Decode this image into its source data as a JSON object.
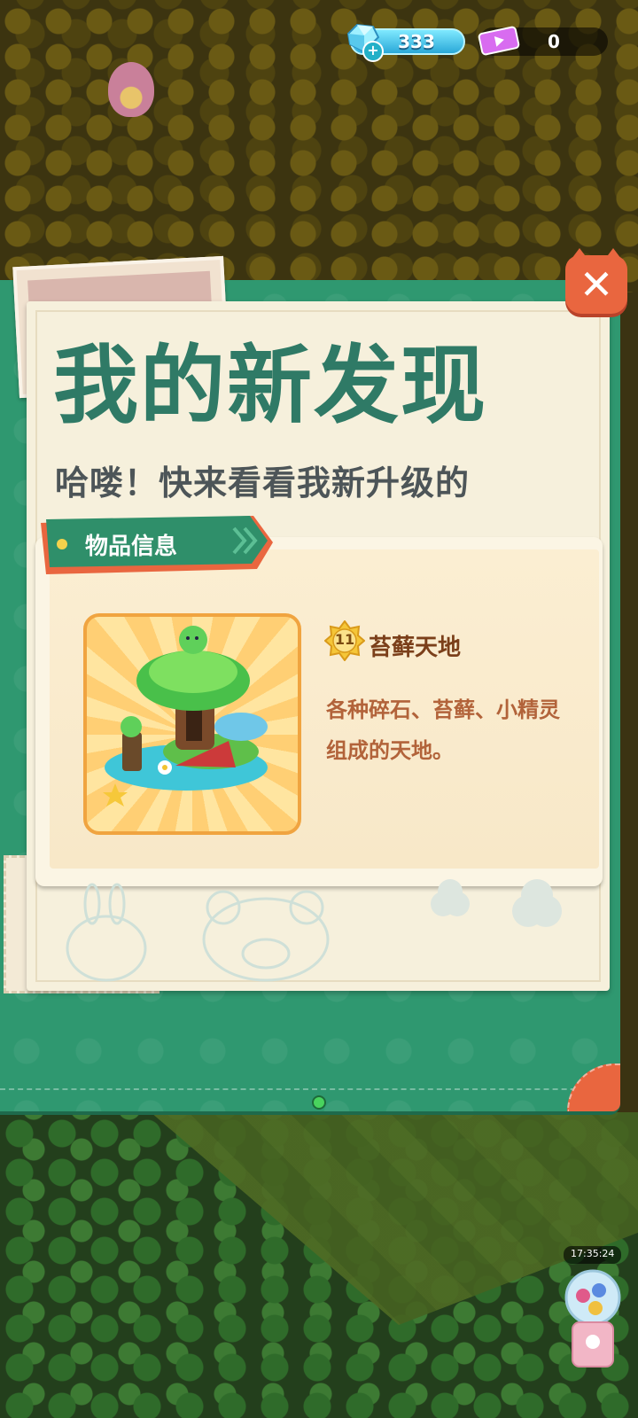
{
  "currencies": {
    "gems": "333",
    "tickets": "0"
  },
  "panel": {
    "title": "我的新发现",
    "subtitle": "哈喽！快来看看我新升级的",
    "section_label": "物品信息",
    "close_label": "✕"
  },
  "item": {
    "level": "11",
    "name": "苔藓天地",
    "description": "各种碎石、苔藓、小精灵组成的天地。"
  },
  "hud": {
    "timer": "17:35:24"
  },
  "colors": {
    "panel_green": "#2f9870",
    "title_green": "#2f7a66",
    "accent_orange": "#e9663f",
    "card_cream": "#f6f0dc"
  }
}
